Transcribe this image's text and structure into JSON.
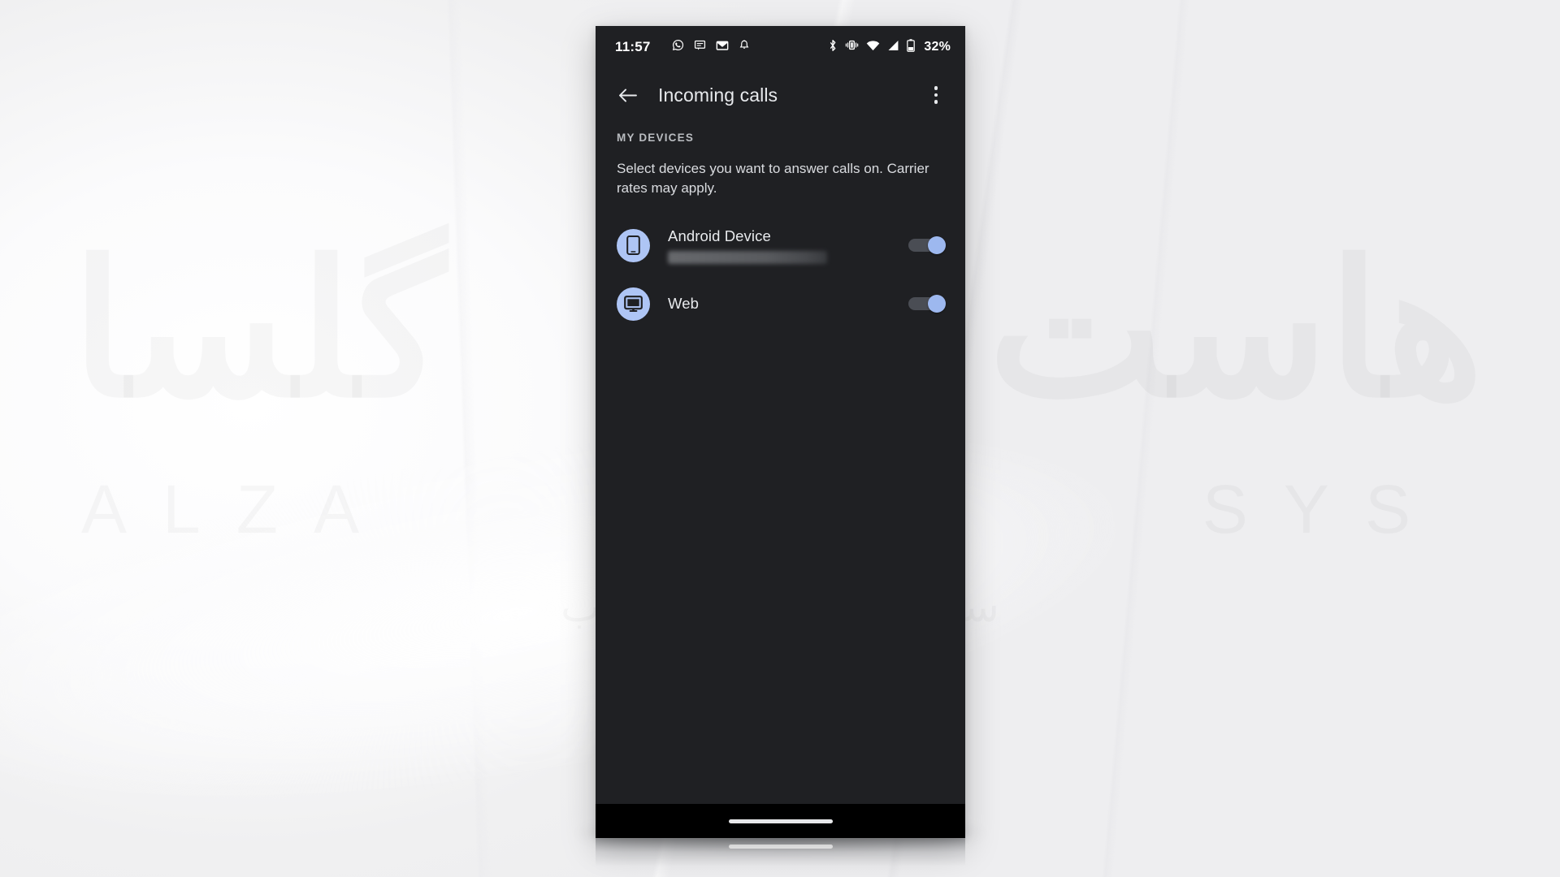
{
  "background": {
    "watermark_main_left": "گلسا",
    "watermark_sub_left": "ALZA",
    "watermark_main_right": "هاست",
    "watermark_sub_right": "SYS",
    "watermark_farsi": "سرویس های میزبانی وب"
  },
  "phone": {
    "status_bar": {
      "time": "11:57",
      "battery_text": "32%",
      "left_icons": [
        "whatsapp-icon",
        "messages-icon",
        "gmail-icon",
        "notification-bell-icon"
      ],
      "right_icons": [
        "bluetooth-icon",
        "vibrate-icon",
        "wifi-icon",
        "cellular-signal-icon",
        "battery-icon"
      ]
    },
    "app_bar": {
      "back_icon": "back-arrow-icon",
      "title": "Incoming calls",
      "overflow_icon": "overflow-menu-icon"
    },
    "content": {
      "section_header": "MY DEVICES",
      "section_description": "Select devices you want to answer calls on. Carrier rates may apply.",
      "devices": [
        {
          "name": "Android Device",
          "icon": "android-phone-icon",
          "subtitle_redacted": true,
          "toggle_on": true,
          "toggle_state_label": "On"
        },
        {
          "name": "Web",
          "icon": "desktop-monitor-icon",
          "subtitle_redacted": false,
          "toggle_on": true,
          "toggle_state_label": "On"
        }
      ]
    },
    "nav_bar": {
      "home_indicator": "home-gesture-pill"
    }
  },
  "colors": {
    "phone_background": "#1f2023",
    "nav_bar": "#000000",
    "accent_icon_circle": "#aec5f5",
    "toggle_thumb_on": "#9db8ef",
    "toggle_track_on": "#4a4d54",
    "primary_text": "#e8eaed",
    "secondary_text": "#b9bcc0",
    "page_background": "#f1f1f2"
  }
}
